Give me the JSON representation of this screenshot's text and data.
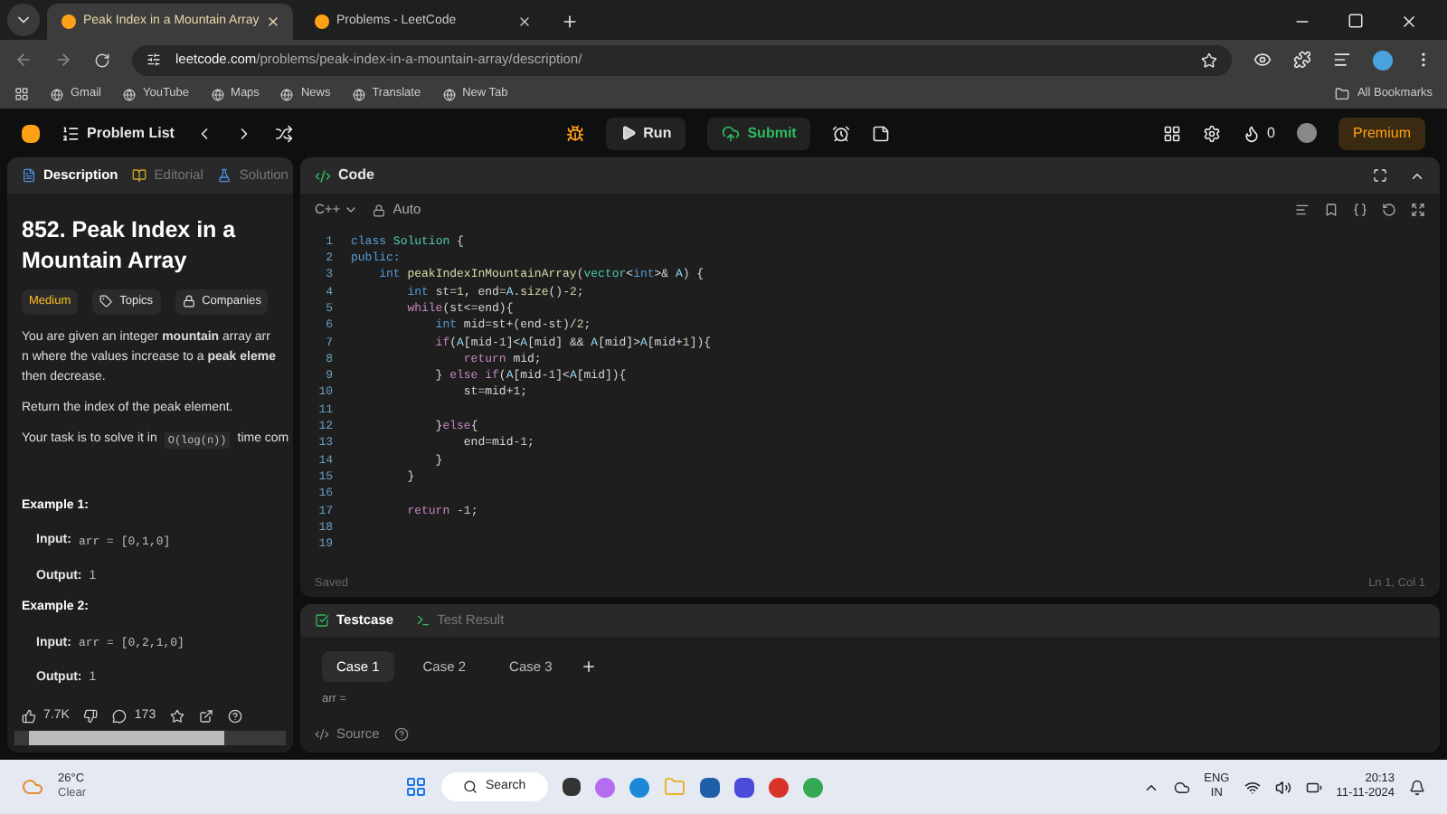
{
  "browser": {
    "tabs": [
      {
        "title": "Peak Index in a Mountain Array",
        "selected": true
      },
      {
        "title": "Problems - LeetCode",
        "selected": false
      }
    ],
    "address": {
      "host": "leetcode.com",
      "path": "/problems/peak-index-in-a-mountain-array/description/"
    },
    "bookmarks": [
      "Gmail",
      "YouTube",
      "Maps",
      "News",
      "Translate",
      "New Tab"
    ],
    "all_bookmarks": "All Bookmarks"
  },
  "toolbar": {
    "problem_list": "Problem List",
    "run": "Run",
    "submit": "Submit",
    "streak": "0",
    "premium": "Premium"
  },
  "description": {
    "tabs": [
      {
        "label": "Description",
        "selected": true
      },
      {
        "label": "Editorial",
        "selected": false
      },
      {
        "label": "Solution",
        "selected": false
      }
    ],
    "title": "852. Peak Index in a Mountain Array",
    "difficulty": "Medium",
    "topics": "Topics",
    "companies": "Companies",
    "intro_lines": [
      "You are given an integer **mountain** array arr",
      "n where the values increase to a **peak eleme**",
      "then decrease."
    ],
    "return_text": "Return the index of the peak element.",
    "task": {
      "before": "Your task is to solve it in",
      "code": "O(log(n))",
      "after": "time com"
    },
    "examples": [
      {
        "heading": "Example 1:",
        "input_label": "Input:",
        "input": "arr = [0,1,0]",
        "output_label": "Output:",
        "output": "1"
      },
      {
        "heading": "Example 2:",
        "input_label": "Input:",
        "input": "arr = [0,2,1,0]",
        "output_label": "Output:",
        "output": "1"
      }
    ],
    "likes": "7.7K",
    "comments": "173"
  },
  "editor": {
    "title": "Code",
    "language": "C++",
    "mode": "Auto",
    "lines": [
      {
        "number": "1",
        "tokens": [
          {
            "kind": "kw",
            "text": "class"
          },
          {
            "kind": "type",
            "text": " Solution"
          },
          {
            "kind": "plain",
            "text": " {"
          }
        ]
      },
      {
        "number": "2",
        "tokens": [
          {
            "kind": "kw",
            "text": "public:"
          }
        ]
      },
      {
        "number": "3",
        "tokens": [
          {
            "kind": "kw",
            "text": "    int"
          },
          {
            "kind": "fn",
            "text": " peakIndexInMountainArray"
          },
          {
            "kind": "plain",
            "text": "("
          },
          {
            "kind": "type",
            "text": "vector"
          },
          {
            "kind": "plain",
            "text": "<"
          },
          {
            "kind": "kw",
            "text": "int"
          },
          {
            "kind": "plain",
            "text": ">& "
          },
          {
            "kind": "var",
            "text": "A"
          },
          {
            "kind": "plain",
            "text": ") {"
          }
        ]
      },
      {
        "number": "4",
        "tokens": [
          {
            "kind": "kw",
            "text": "        int"
          },
          {
            "kind": "plain",
            "text": " st="
          },
          {
            "kind": "num",
            "text": "1"
          },
          {
            "kind": "plain",
            "text": ", end="
          },
          {
            "kind": "var",
            "text": "A"
          },
          {
            "kind": "plain",
            "text": "."
          },
          {
            "kind": "fn",
            "text": "size"
          },
          {
            "kind": "plain",
            "text": "()-"
          },
          {
            "kind": "num",
            "text": "2"
          },
          {
            "kind": "plain",
            "text": ";"
          }
        ]
      },
      {
        "number": "5",
        "tokens": [
          {
            "kind": "ctrl",
            "text": "        while"
          },
          {
            "kind": "plain",
            "text": "(st<=end){"
          }
        ]
      },
      {
        "number": "6",
        "tokens": [
          {
            "kind": "kw",
            "text": "            int"
          },
          {
            "kind": "plain",
            "text": " mid=st+(end-st)/"
          },
          {
            "kind": "num",
            "text": "2"
          },
          {
            "kind": "plain",
            "text": ";"
          }
        ]
      },
      {
        "number": "7",
        "tokens": [
          {
            "kind": "ctrl",
            "text": "            if"
          },
          {
            "kind": "plain",
            "text": "("
          },
          {
            "kind": "var",
            "text": "A"
          },
          {
            "kind": "plain",
            "text": "[mid-"
          },
          {
            "kind": "num",
            "text": "1"
          },
          {
            "kind": "plain",
            "text": "]<"
          },
          {
            "kind": "var",
            "text": "A"
          },
          {
            "kind": "plain",
            "text": "[mid] && "
          },
          {
            "kind": "var",
            "text": "A"
          },
          {
            "kind": "plain",
            "text": "[mid]>"
          },
          {
            "kind": "var",
            "text": "A"
          },
          {
            "kind": "plain",
            "text": "[mid+"
          },
          {
            "kind": "num",
            "text": "1"
          },
          {
            "kind": "plain",
            "text": "]){"
          }
        ]
      },
      {
        "number": "8",
        "tokens": [
          {
            "kind": "ctrl",
            "text": "                return"
          },
          {
            "kind": "plain",
            "text": " mid;"
          }
        ]
      },
      {
        "number": "9",
        "tokens": [
          {
            "kind": "plain",
            "text": "            } "
          },
          {
            "kind": "ctrl",
            "text": "else if"
          },
          {
            "kind": "plain",
            "text": "("
          },
          {
            "kind": "var",
            "text": "A"
          },
          {
            "kind": "plain",
            "text": "[mid-"
          },
          {
            "kind": "num",
            "text": "1"
          },
          {
            "kind": "plain",
            "text": "]<"
          },
          {
            "kind": "var",
            "text": "A"
          },
          {
            "kind": "plain",
            "text": "[mid]){"
          }
        ]
      },
      {
        "number": "10",
        "tokens": [
          {
            "kind": "plain",
            "text": "                st=mid+"
          },
          {
            "kind": "num",
            "text": "1"
          },
          {
            "kind": "plain",
            "text": ";"
          }
        ]
      },
      {
        "number": "11"
      },
      {
        "number": "12",
        "tokens": [
          {
            "kind": "plain",
            "text": "            }"
          },
          {
            "kind": "ctrl",
            "text": "else"
          },
          {
            "kind": "plain",
            "text": "{"
          }
        ]
      },
      {
        "number": "13",
        "tokens": [
          {
            "kind": "plain",
            "text": "                end=mid-"
          },
          {
            "kind": "num",
            "text": "1"
          },
          {
            "kind": "plain",
            "text": ";"
          }
        ]
      },
      {
        "number": "14",
        "tokens": [
          {
            "kind": "plain",
            "text": "            }"
          }
        ]
      },
      {
        "number": "15",
        "tokens": [
          {
            "kind": "plain",
            "text": "        }"
          }
        ]
      },
      {
        "number": "16"
      },
      {
        "number": "17",
        "tokens": [
          {
            "kind": "ctrl",
            "text": "        return"
          },
          {
            "kind": "plain",
            "text": " -"
          },
          {
            "kind": "num",
            "text": "1"
          },
          {
            "kind": "plain",
            "text": ";"
          }
        ]
      },
      {
        "number": "18"
      },
      {
        "number": "19"
      }
    ],
    "status": "Saved",
    "position": "Ln 1, Col 1"
  },
  "testcase": {
    "tabs": [
      {
        "label": "Testcase",
        "selected": true
      },
      {
        "label": "Test Result",
        "selected": false
      }
    ],
    "cases": [
      {
        "label": "Case 1",
        "selected": true
      },
      {
        "label": "Case 2",
        "selected": false
      },
      {
        "label": "Case 3",
        "selected": false
      }
    ],
    "param": "arr =",
    "source": "Source"
  },
  "taskbar": {
    "temperature": "26°C",
    "weather": "Clear",
    "search": "Search",
    "language": "ENG",
    "region": "IN",
    "time": "20:13",
    "date": "11-11-2024"
  }
}
